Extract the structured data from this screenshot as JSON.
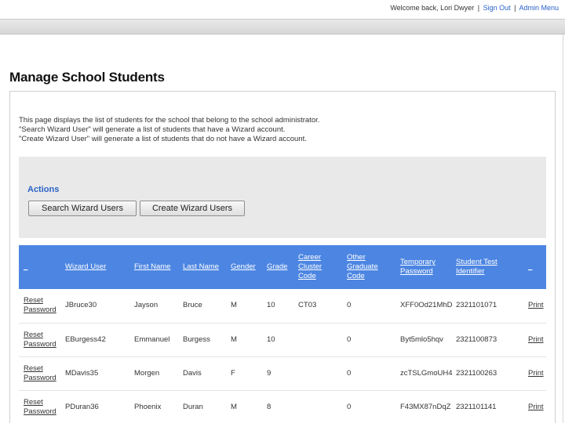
{
  "header": {
    "welcome_text": "Welcome back, Lori Dwyer",
    "sign_out_link": "Sign Out",
    "admin_menu_link": "Admin Menu",
    "separator": "|"
  },
  "page": {
    "title": "Manage School Students",
    "description_lines": [
      "This page displays the list of students for the school that belong to the school administrator.",
      "\"Search Wizard User\" will generate a list of students that have a Wizard account.",
      "\"Create Wizard User\" will generate a list of students that do not have a Wizard account."
    ]
  },
  "actions": {
    "title": "Actions",
    "search_button": "Search Wizard Users",
    "create_button": "Create Wizard Users"
  },
  "table": {
    "columns": [
      "_",
      "Wizard User",
      "First Name",
      "Last Name",
      "Gender",
      "Grade",
      "Career Cluster Code",
      "Other Graduate Code",
      "Temporary Password",
      "Student Test Identifier",
      "_"
    ],
    "rows": [
      [
        "Reset Password",
        "JBruce30",
        "Jayson",
        "Bruce",
        "M",
        "10",
        "CT03",
        "0",
        "XFF0Od21MhD",
        "2321101071",
        "Print"
      ],
      [
        "Reset Password",
        "EBurgess42",
        "Emmanuel",
        "Burgess",
        "M",
        "10",
        "",
        "0",
        "Byt5mlo5hqv",
        "2321100873",
        "Print"
      ],
      [
        "Reset Password",
        "MDavis35",
        "Morgen",
        "Davis",
        "F",
        "9",
        "",
        "0",
        "zcTSLGmoUH4",
        "2321100263",
        "Print"
      ],
      [
        "Reset Password",
        "PDuran36",
        "Phoenix",
        "Duran",
        "M",
        "8",
        "",
        "0",
        "F43MX87nDqZ",
        "2321101141",
        "Print"
      ]
    ]
  },
  "colors": {
    "header_blue": "#4d86e2",
    "link_blue": "#2a62c9",
    "actions_title": "#2b63c6",
    "panel_gray": "#e9e9e9"
  }
}
